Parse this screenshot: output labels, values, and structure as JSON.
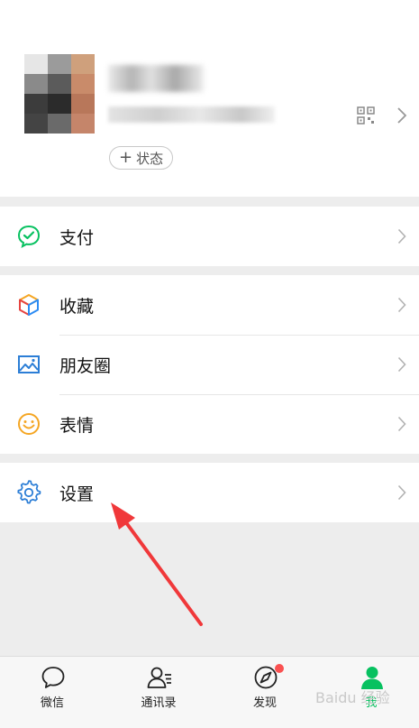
{
  "profile": {
    "status_button_label": "状态"
  },
  "menu": {
    "pay": "支付",
    "favorites": "收藏",
    "moments": "朋友圈",
    "stickers": "表情",
    "settings": "设置"
  },
  "tabs": [
    {
      "label": "微信",
      "icon": "chat-bubble-icon"
    },
    {
      "label": "通讯录",
      "icon": "contacts-icon"
    },
    {
      "label": "发现",
      "icon": "compass-icon"
    },
    {
      "label": "我",
      "icon": "me-person-icon"
    }
  ],
  "colors": {
    "brand_green": "#07c160",
    "badge_red": "#fa5151",
    "annotation_arrow": "#f0383a"
  },
  "watermark_text": "Baidu 经验"
}
